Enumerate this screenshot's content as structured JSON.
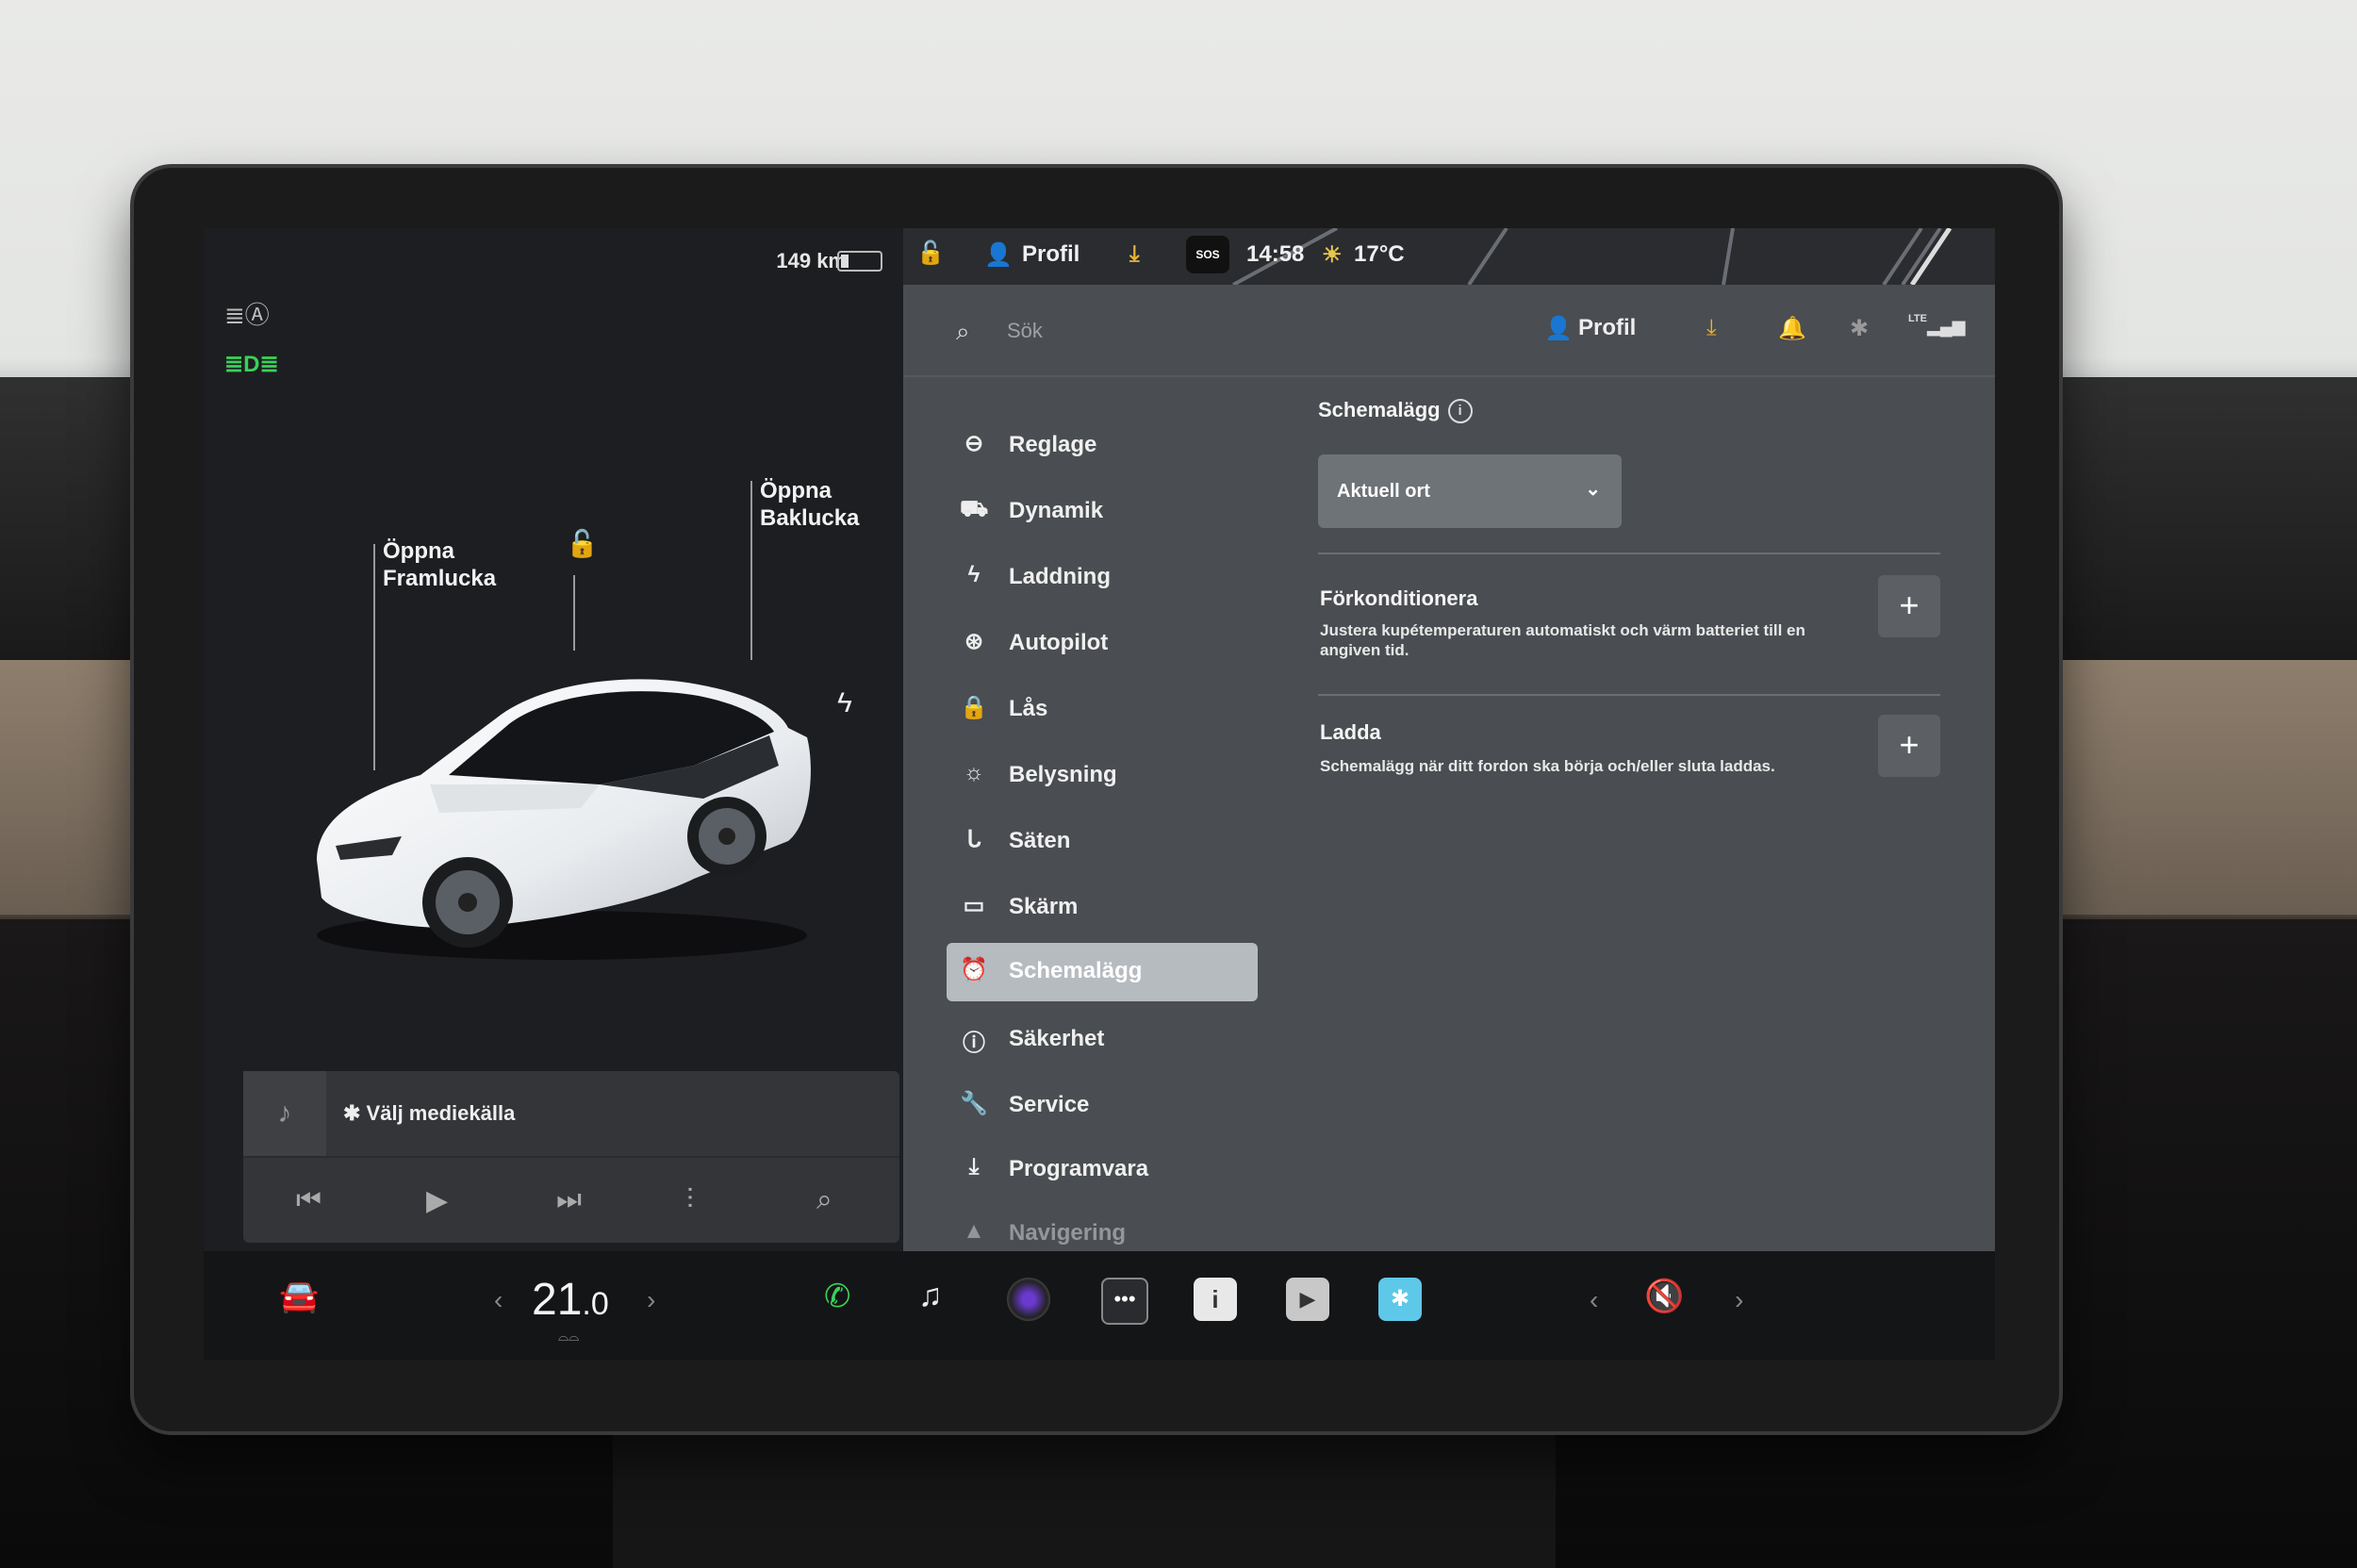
{
  "status": {
    "range": "149 km",
    "profile": "Profil",
    "sos": "SOS",
    "time": "14:58",
    "temperature": "17°C"
  },
  "car_panel": {
    "frunk_label": "Öppna\nFramlucka",
    "trunk_label": "Öppna\nBaklucka"
  },
  "media": {
    "source_label": "Välj mediekälla"
  },
  "header": {
    "search_placeholder": "Sök",
    "profile": "Profil",
    "lte": "LTE"
  },
  "menu": {
    "items": [
      {
        "label": "Reglage",
        "icon": "toggle-icon"
      },
      {
        "label": "Dynamik",
        "icon": "car-icon"
      },
      {
        "label": "Laddning",
        "icon": "bolt-icon"
      },
      {
        "label": "Autopilot",
        "icon": "steering-wheel-icon"
      },
      {
        "label": "Lås",
        "icon": "lock-icon"
      },
      {
        "label": "Belysning",
        "icon": "sun-icon"
      },
      {
        "label": "Säten",
        "icon": "seat-icon"
      },
      {
        "label": "Skärm",
        "icon": "display-icon"
      },
      {
        "label": "Schemalägg",
        "icon": "clock-icon"
      },
      {
        "label": "Säkerhet",
        "icon": "alert-icon"
      },
      {
        "label": "Service",
        "icon": "wrench-icon"
      },
      {
        "label": "Programvara",
        "icon": "download-icon"
      },
      {
        "label": "Navigering",
        "icon": "navigation-icon"
      }
    ],
    "active": "Schemalägg"
  },
  "schedule": {
    "title": "Schemalägg",
    "location_select": "Aktuell ort",
    "precondition_title": "Förkonditionera",
    "precondition_desc": "Justera kupétemperaturen automatiskt och värm batteriet till en angiven tid.",
    "charge_title": "Ladda",
    "charge_desc": "Schemalägg när ditt fordon ska börja och/eller sluta laddas."
  },
  "bottom_bar": {
    "temp_whole": "21",
    "temp_decimal": ".0"
  },
  "colors": {
    "accent_download": "#e8b53a",
    "drl_green": "#3ad15a",
    "bluetooth_tile": "#5ec8e8"
  }
}
